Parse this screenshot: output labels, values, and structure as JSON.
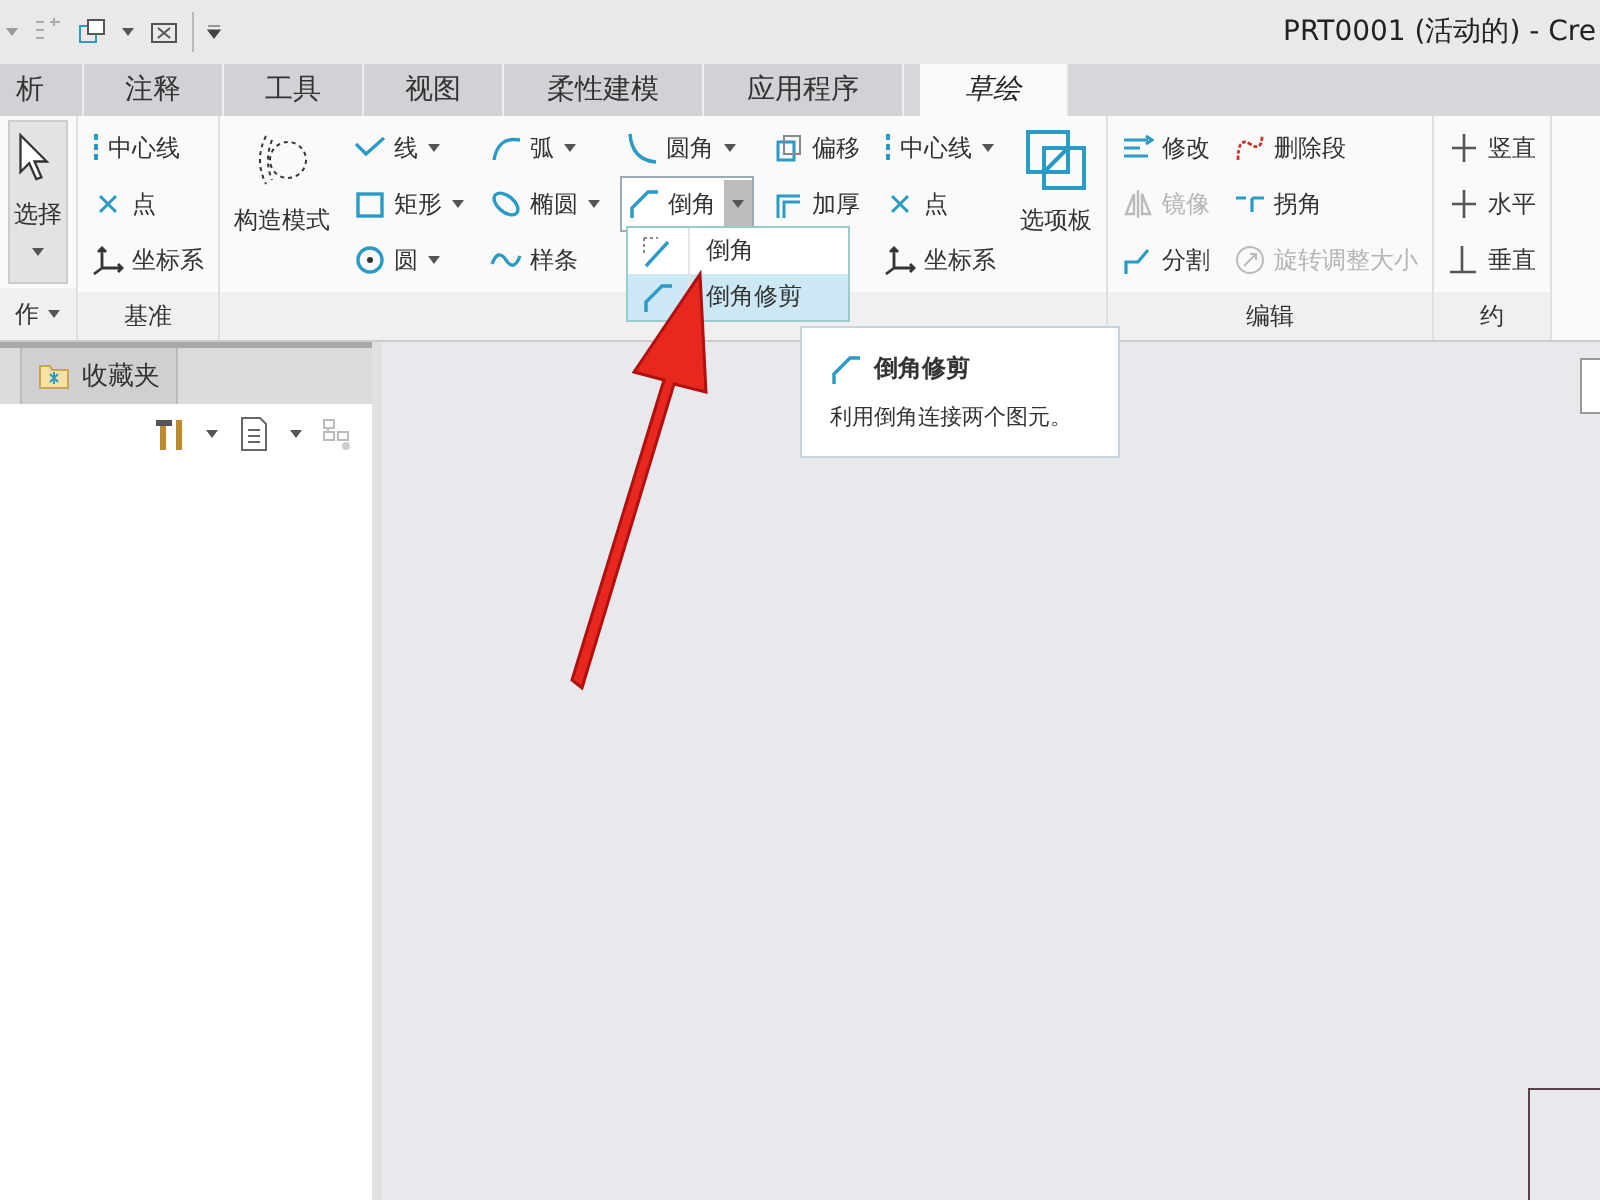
{
  "title": "PRT0001 (活动的) - Cre",
  "tabs": [
    {
      "label": "析",
      "selected": false
    },
    {
      "label": "注释",
      "selected": false
    },
    {
      "label": "工具",
      "selected": false
    },
    {
      "label": "视图",
      "selected": false
    },
    {
      "label": "柔性建模",
      "selected": false
    },
    {
      "label": "应用程序",
      "selected": false
    },
    {
      "label": "草绘",
      "selected": true
    }
  ],
  "ribbon": {
    "groups": [
      {
        "label": "作",
        "label_dropdown": true,
        "parts": [
          {
            "kind": "large",
            "label": "选择",
            "dropdown": true
          }
        ]
      },
      {
        "label": "基准",
        "label_dropdown": false,
        "parts": [
          {
            "kind": "column",
            "items": [
              {
                "label": "中心线",
                "dropdown": false,
                "disabled": false,
                "pressed": false
              },
              {
                "label": "点",
                "dropdown": false,
                "disabled": false,
                "pressed": false
              },
              {
                "label": "坐标系",
                "dropdown": false,
                "disabled": false,
                "pressed": false
              }
            ]
          }
        ]
      },
      {
        "label_dropdown": false,
        "parts": [
          {
            "kind": "large",
            "label": "构造模式",
            "dropdown": false
          },
          {
            "kind": "column",
            "items": [
              {
                "label": "线",
                "dropdown": true,
                "disabled": false,
                "pressed": false
              },
              {
                "label": "矩形",
                "dropdown": true,
                "disabled": false,
                "pressed": false
              },
              {
                "label": "圆",
                "dropdown": true,
                "disabled": false,
                "pressed": false
              }
            ]
          },
          {
            "kind": "column",
            "items": [
              {
                "label": "弧",
                "dropdown": true,
                "disabled": false,
                "pressed": false
              },
              {
                "label": "椭圆",
                "dropdown": true,
                "disabled": false,
                "pressed": false
              },
              {
                "label": "样条",
                "dropdown": false,
                "disabled": false,
                "pressed": false
              }
            ]
          },
          {
            "kind": "column",
            "items": [
              {
                "label": "圆角",
                "dropdown": true,
                "disabled": false,
                "pressed": false
              },
              {
                "label": "倒角",
                "dropdown": true,
                "disabled": false,
                "pressed": true
              }
            ]
          },
          {
            "kind": "column",
            "items": [
              {
                "label": "偏移",
                "dropdown": false,
                "disabled": false,
                "pressed": false
              },
              {
                "label": "加厚",
                "dropdown": false,
                "disabled": false,
                "pressed": false
              }
            ]
          },
          {
            "kind": "column",
            "items": [
              {
                "label": "中心线",
                "dropdown": true,
                "disabled": false,
                "pressed": false
              },
              {
                "label": "点",
                "dropdown": false,
                "disabled": false,
                "pressed": false
              },
              {
                "label": "坐标系",
                "dropdown": false,
                "disabled": false,
                "pressed": false
              }
            ]
          },
          {
            "kind": "large",
            "label": "选项板",
            "dropdown": false
          }
        ]
      },
      {
        "label": "编辑",
        "label_dropdown": false,
        "parts": [
          {
            "kind": "column",
            "items": [
              {
                "label": "修改",
                "dropdown": false,
                "disabled": false,
                "pressed": false
              },
              {
                "label": "镜像",
                "dropdown": false,
                "disabled": true,
                "pressed": false
              },
              {
                "label": "分割",
                "dropdown": false,
                "disabled": false,
                "pressed": false
              }
            ]
          },
          {
            "kind": "column",
            "items": [
              {
                "label": "删除段",
                "dropdown": false,
                "disabled": false,
                "pressed": false
              },
              {
                "label": "拐角",
                "dropdown": false,
                "disabled": false,
                "pressed": false
              },
              {
                "label": "旋转调整大小",
                "dropdown": false,
                "disabled": true,
                "pressed": false
              }
            ]
          }
        ]
      },
      {
        "label": "约",
        "label_dropdown": false,
        "parts": [
          {
            "kind": "column",
            "items": [
              {
                "label": "竖直",
                "dropdown": false,
                "disabled": false,
                "pressed": false
              },
              {
                "label": "水平",
                "dropdown": false,
                "disabled": false,
                "pressed": false
              },
              {
                "label": "垂直",
                "dropdown": false,
                "disabled": false,
                "pressed": false
              }
            ]
          }
        ]
      }
    ]
  },
  "dropdown_menu": {
    "items": [
      {
        "label": "倒角",
        "selected": false
      },
      {
        "label": "倒角修剪",
        "selected": true
      }
    ]
  },
  "tooltip": {
    "title": "倒角修剪",
    "description": "利用倒角连接两个图元。"
  },
  "left_panel": {
    "tabs": [
      {
        "label": "收藏夹"
      }
    ]
  }
}
